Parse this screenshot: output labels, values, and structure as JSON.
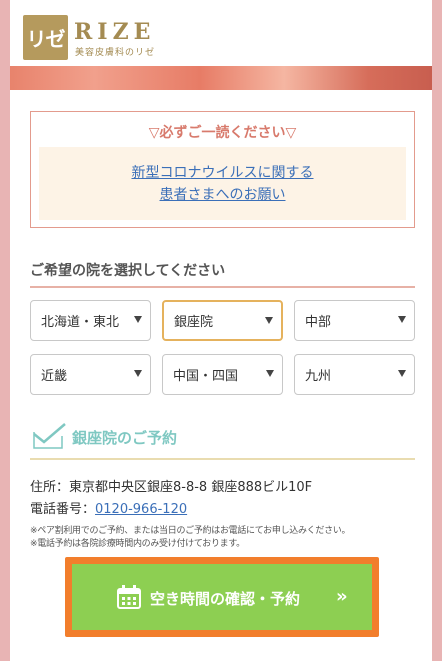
{
  "header": {
    "logo_mark": "リゼ",
    "logo_text": "RIZE",
    "logo_sub": "美容皮膚科のリゼ"
  },
  "notice": {
    "title": "▽必ずご一読ください▽",
    "link_line1": "新型コロナウイルスに関する",
    "link_line2": "患者さまへのお願い"
  },
  "clinic_select": {
    "heading": "ご希望の院を選択してください",
    "options": [
      {
        "label": "北海道・東北"
      },
      {
        "label": "銀座院"
      },
      {
        "label": "中部"
      },
      {
        "label": "近畿"
      },
      {
        "label": "中国・四国"
      },
      {
        "label": "九州"
      }
    ]
  },
  "reservation": {
    "title": "銀座院のご予約",
    "address": "住所：東京都中央区銀座8-8-8 銀座888ビル10F",
    "tel_label": "電話番号：",
    "tel_number": "0120-966-120",
    "note1": "※ペア割利用でのご予約、または当日のご予約はお電話にてお申し込みください。",
    "note2": "※電話予約は各院診療時間内のみ受け付けております。",
    "cta_label": "空き時間の確認・予約",
    "cta_chevron": "»"
  },
  "colors": {
    "background": "#e8b4b4",
    "brand_gold": "#b59a5d",
    "notice_border": "#e39b8d",
    "accent_teal": "#7fc8c2",
    "cta_green": "#8dcf52",
    "cta_orange": "#f27e2c"
  }
}
